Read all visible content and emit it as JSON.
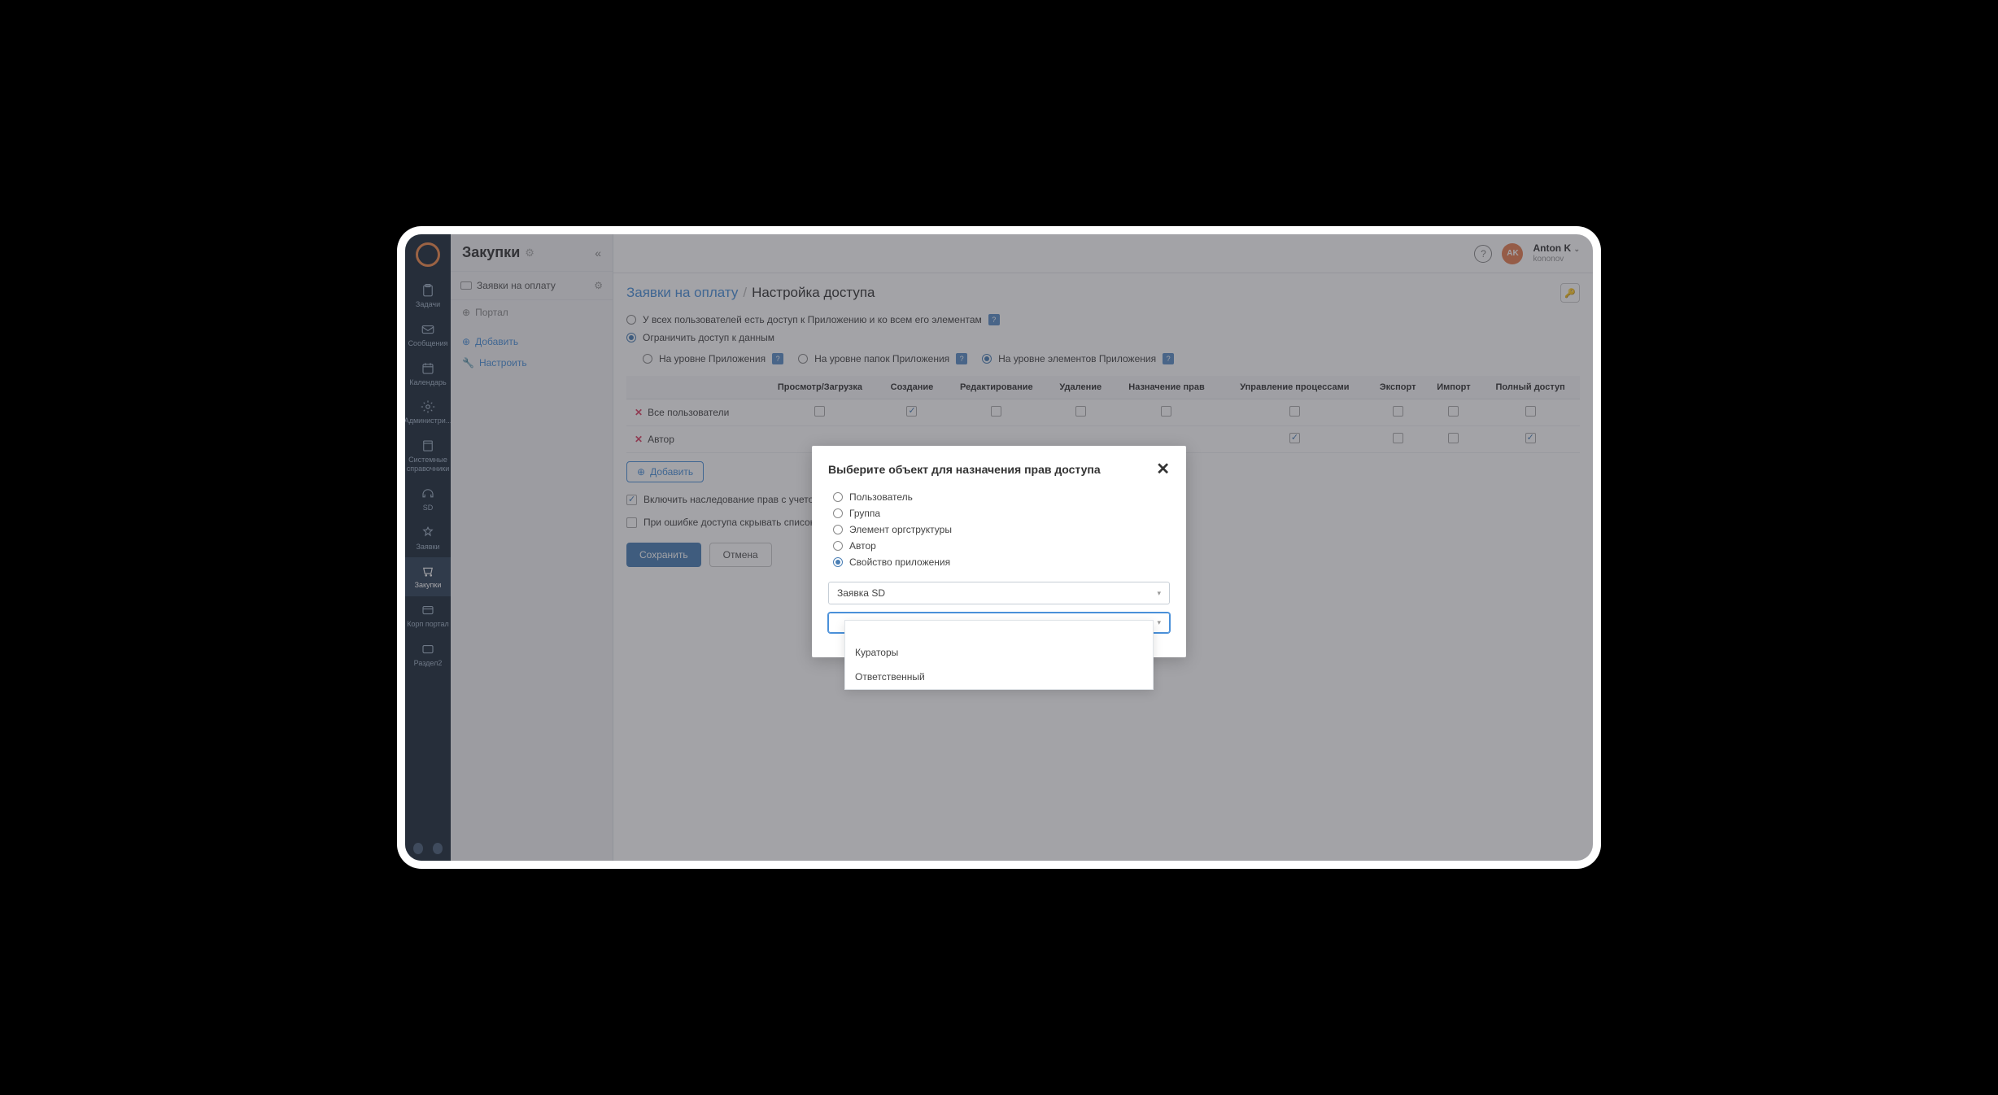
{
  "app_name": "Закупки",
  "user": {
    "initials": "AK",
    "name": "Anton K",
    "login": "kononov"
  },
  "nav_rail": {
    "items": [
      {
        "label": "Задачи"
      },
      {
        "label": "Сообщения"
      },
      {
        "label": "Календарь"
      },
      {
        "label": "Администри..."
      },
      {
        "label": "Системные справочники"
      },
      {
        "label": "SD"
      },
      {
        "label": "Заявки"
      },
      {
        "label": "Закупки"
      },
      {
        "label": "Корп портал"
      },
      {
        "label": "Раздел2"
      }
    ]
  },
  "sidebar": {
    "section_title": "Заявки на оплату",
    "portal": "Портал",
    "add": "Добавить",
    "configure": "Настроить"
  },
  "breadcrumb": {
    "root": "Заявки на оплату",
    "current": "Настройка доступа"
  },
  "access_options": {
    "all_users": "У всех пользователей есть доступ к Приложению и ко всем его элементам",
    "restrict": "Ограничить доступ к данным",
    "level_app": "На уровне Приложения",
    "level_folders": "На уровне папок Приложения",
    "level_elements": "На уровне элементов Приложения"
  },
  "table": {
    "headers": [
      "",
      "Просмотр/Загрузка",
      "Создание",
      "Редактирование",
      "Удаление",
      "Назначение прав",
      "Управление процессами",
      "Экспорт",
      "Импорт",
      "Полный доступ"
    ],
    "rows": [
      {
        "name": "Все пользователи",
        "cells": [
          false,
          true,
          false,
          false,
          false,
          false,
          false,
          false,
          false
        ]
      },
      {
        "name": "Автор",
        "cells": [
          null,
          null,
          null,
          null,
          null,
          true,
          false,
          false,
          true
        ]
      }
    ]
  },
  "add_button": "Добавить",
  "inherit": "Включить наследование прав с учетом",
  "hide_on_error": "При ошибке доступа скрывать список",
  "save": "Сохранить",
  "cancel": "Отмена",
  "modal": {
    "title": "Выберите объект для назначения прав доступа",
    "options": {
      "user": "Пользователь",
      "group": "Группа",
      "org_element": "Элемент оргструктуры",
      "author": "Автор",
      "app_property": "Свойство приложения"
    },
    "select1_value": "Заявка SD",
    "select2_value": "",
    "dropdown": {
      "opt1": "Кураторы",
      "opt2": "Ответственный"
    }
  }
}
